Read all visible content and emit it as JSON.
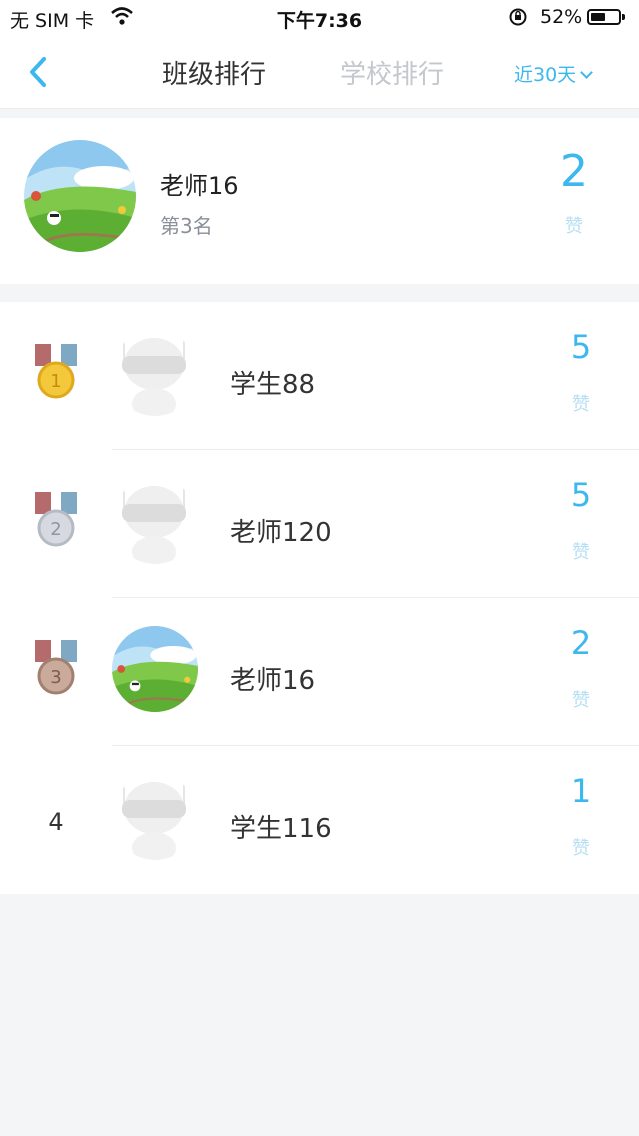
{
  "status": {
    "carrier": "无 SIM 卡",
    "time": "下午7:36",
    "battery": "52%",
    "battery_level": 0.52
  },
  "nav": {
    "tabs": [
      "班级排行",
      "学校排行"
    ],
    "active_tab": "班级排行",
    "range": "近30天"
  },
  "me": {
    "name": "老师16",
    "rank": "第3名",
    "likes": "2",
    "unit": "赞",
    "avatar": "landscape-avatar"
  },
  "rankings": [
    {
      "rank": "1",
      "badge": "gold-medal-icon",
      "name": "学生88",
      "likes": "5",
      "unit": "赞",
      "avatar": "default-robot-avatar"
    },
    {
      "rank": "2",
      "badge": "silver-medal-icon",
      "name": "老师120",
      "likes": "5",
      "unit": "赞",
      "avatar": "default-robot-avatar"
    },
    {
      "rank": "3",
      "badge": "bronze-medal-icon",
      "name": "老师16",
      "likes": "2",
      "unit": "赞",
      "avatar": "landscape-avatar"
    },
    {
      "rank": "4",
      "badge": "",
      "name": "学生116",
      "likes": "1",
      "unit": "赞",
      "avatar": "default-robot-avatar"
    }
  ],
  "colors": {
    "accent": "#3db8ef",
    "gold": "#f3c83a",
    "silver": "#c9ced6",
    "bronze": "#b89a8c"
  }
}
